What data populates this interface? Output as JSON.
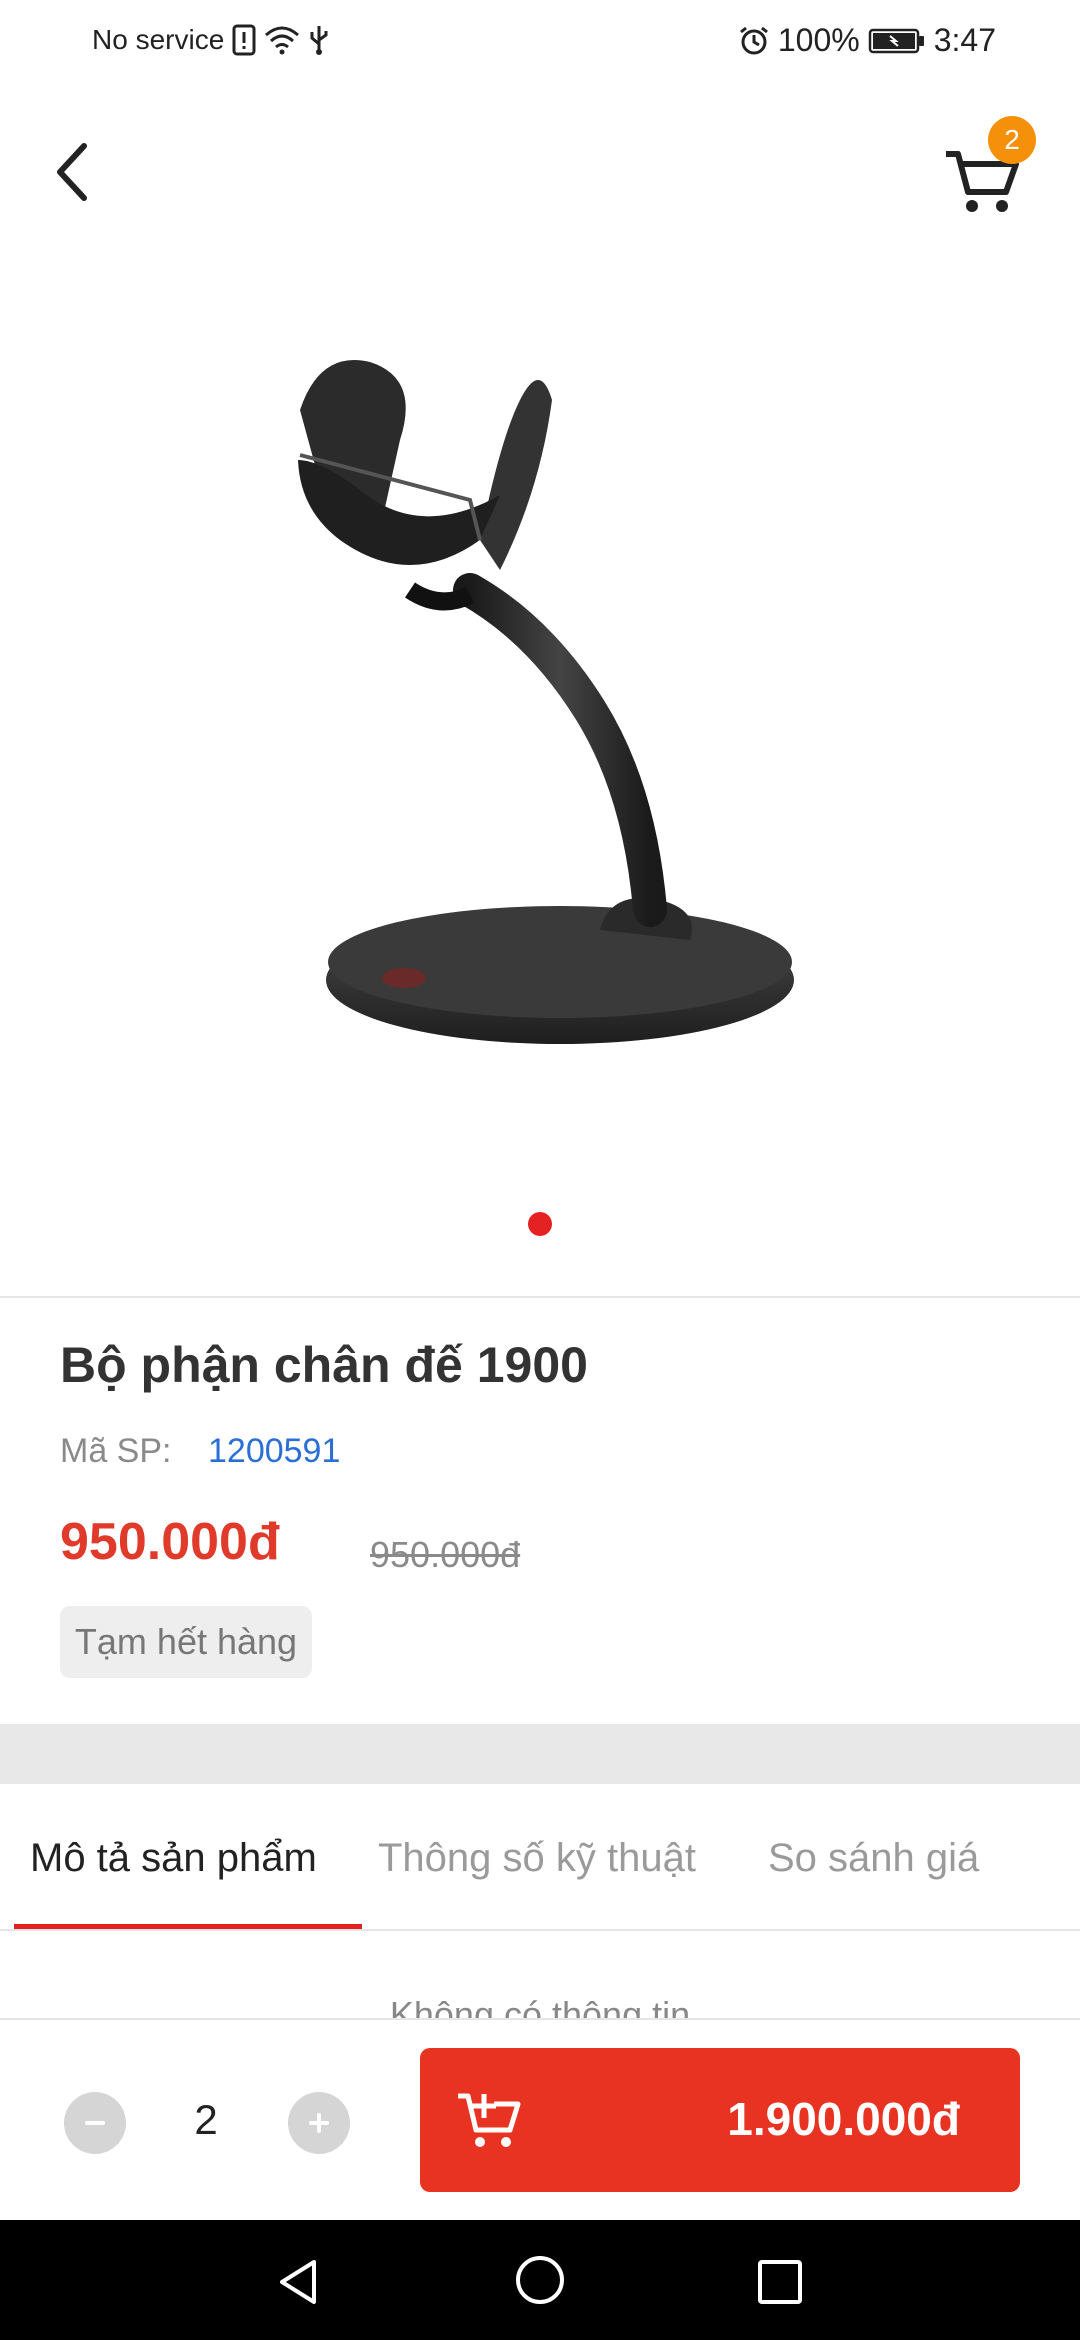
{
  "status_bar": {
    "carrier": "No service",
    "battery": "100%",
    "time": "3:47"
  },
  "header": {
    "cart_count": "2"
  },
  "product": {
    "title": "Bộ phận chân đế 1900",
    "sku_label": "Mã SP:",
    "sku_value": "1200591",
    "price": "950.000đ",
    "old_price": "950.000đ",
    "stock_status": "Tạm hết hàng",
    "image_count": 1,
    "image_index": 1
  },
  "tabs": [
    {
      "label": "Mô tả sản phẩm",
      "active": true
    },
    {
      "label": "Thông số kỹ thuật",
      "active": false
    },
    {
      "label": "So sánh giá",
      "active": false
    }
  ],
  "content": {
    "no_info": "Không có thông tin"
  },
  "purchase": {
    "quantity": "2",
    "total": "1.900.000đ"
  },
  "colors": {
    "accent_red": "#e83322",
    "badge_orange": "#f5900b",
    "link_blue": "#2b6fd6"
  },
  "icons": [
    "back-arrow-icon",
    "cart-icon",
    "minus-icon",
    "plus-icon",
    "add-to-cart-icon",
    "alarm-icon",
    "wifi-icon",
    "usb-icon",
    "battery-icon"
  ]
}
